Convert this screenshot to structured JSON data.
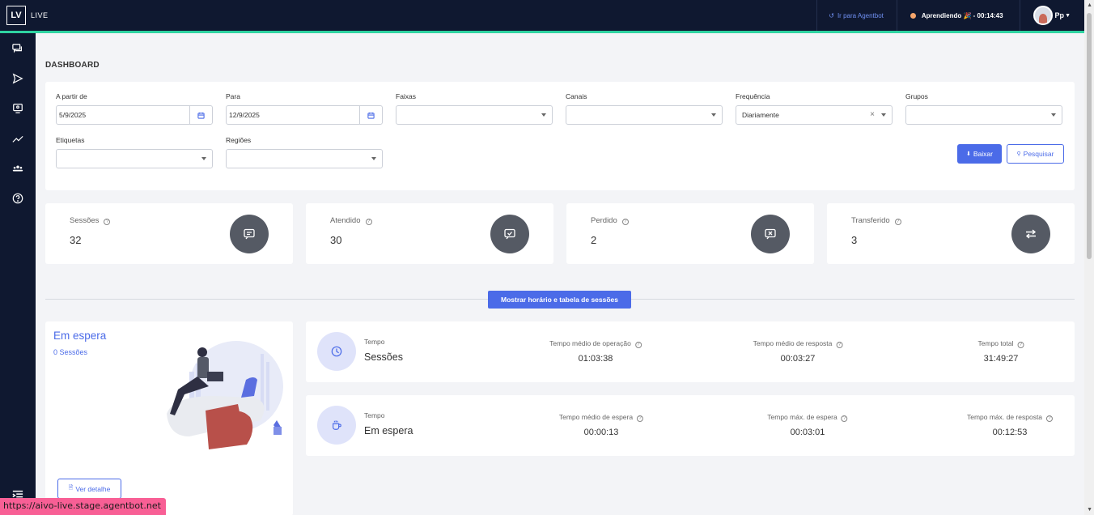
{
  "topbar": {
    "logo": "LV",
    "app_name": "LIVE",
    "agentbot_link": "Ir para Agentbot",
    "status_text": "Aprendiendo 🎉 - 00:14:43",
    "user_initials": "Pp"
  },
  "page": {
    "title": "DASHBOARD"
  },
  "filters": {
    "from_label": "A partir de",
    "from_value": "5/9/2025",
    "to_label": "Para",
    "to_value": "12/9/2025",
    "faixas_label": "Faixas",
    "canais_label": "Canais",
    "frequencia_label": "Frequência",
    "frequencia_value": "Diariamente",
    "grupos_label": "Grupos",
    "etiquetas_label": "Etiquetas",
    "regioes_label": "Regiões",
    "baixar_label": "Baixar",
    "pesquisar_label": "Pesquisar"
  },
  "stats": [
    {
      "label": "Sessões",
      "value": "32",
      "icon": "chat-icon"
    },
    {
      "label": "Atendido",
      "value": "30",
      "icon": "chat-check-icon"
    },
    {
      "label": "Perdido",
      "value": "2",
      "icon": "chat-x-icon"
    },
    {
      "label": "Transferido",
      "value": "3",
      "icon": "transfer-icon"
    }
  ],
  "toggle_label": "Mostrar horário e tabela de sessões",
  "waiting": {
    "title": "Em espera",
    "count": "0 Sessões",
    "detail_button": "Ver detalhe"
  },
  "metrics": [
    {
      "tempo": "Tempo",
      "name": "Sessões",
      "cols": [
        {
          "label": "Tempo médio de operação",
          "value": "01:03:38"
        },
        {
          "label": "Tempo médio de resposta",
          "value": "00:03:27"
        },
        {
          "label": "Tempo total",
          "value": "31:49:27"
        }
      ]
    },
    {
      "tempo": "Tempo",
      "name": "Em espera",
      "cols": [
        {
          "label": "Tempo médio de espera",
          "value": "00:00:13"
        },
        {
          "label": "Tempo máx. de espera",
          "value": "00:03:01"
        },
        {
          "label": "Tempo máx. de resposta",
          "value": "00:12:53"
        }
      ]
    }
  ],
  "url_status": "https://aivo-live.stage.agentbot.net",
  "colors": {
    "primary": "#4b6be8",
    "sidebar": "#0f1830",
    "accent": "#2fd3a1"
  }
}
